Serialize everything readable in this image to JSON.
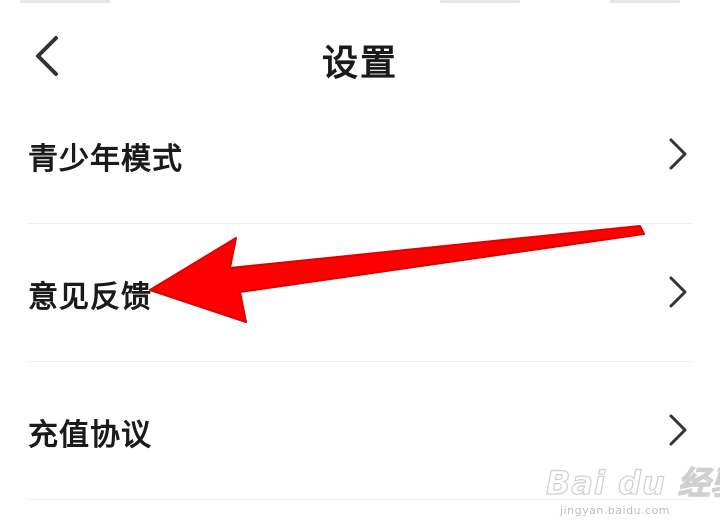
{
  "header": {
    "title": "设置",
    "back_icon": "chevron-left-icon"
  },
  "settings": {
    "items": [
      {
        "label": "青少年模式",
        "icon": "chevron-right-icon"
      },
      {
        "label": "意见反馈",
        "icon": "chevron-right-icon"
      },
      {
        "label": "充值协议",
        "icon": "chevron-right-icon"
      }
    ]
  },
  "annotation": {
    "arrow_color": "#ff0000",
    "points_to": "意见反馈"
  },
  "watermark": {
    "logo": "Bai du 经验",
    "url": "jingyan.baidu.com"
  },
  "colors": {
    "background": "#ffffff",
    "text": "#1a1a1a",
    "chevron": "#333333",
    "divider": "#efefef"
  }
}
